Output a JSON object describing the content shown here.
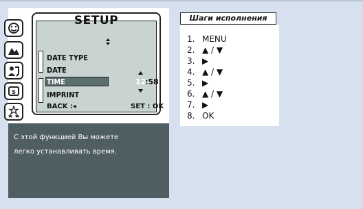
{
  "lcd": {
    "title": "SETUP",
    "menu_items": [
      "DATE TYPE",
      "DATE",
      "TIME",
      "IMPRINT"
    ],
    "time_hour": "12",
    "time_rest": ":58",
    "back_label": "BACK :◂",
    "set_label": "SET : OK"
  },
  "mode_icons": [
    "smile-mode-icon",
    "landscape-icon",
    "portrait-icon",
    "sports-icon",
    "stars-icon"
  ],
  "info": {
    "line1": "С этой функцией Вы можете",
    "line2": "легко устанавливать время."
  },
  "steps": {
    "header": "Шаги исполнения",
    "items": [
      {
        "num": "1.",
        "text": "MENU"
      },
      {
        "num": "2.",
        "text": "▲ / ▼"
      },
      {
        "num": "3.",
        "text": "▶"
      },
      {
        "num": "4.",
        "text": "▲ / ▼"
      },
      {
        "num": "5.",
        "text": "▶"
      },
      {
        "num": "6.",
        "text": "▲ / ▼"
      },
      {
        "num": "7.",
        "text": "▶"
      },
      {
        "num": "8.",
        "text": "OK"
      }
    ]
  }
}
